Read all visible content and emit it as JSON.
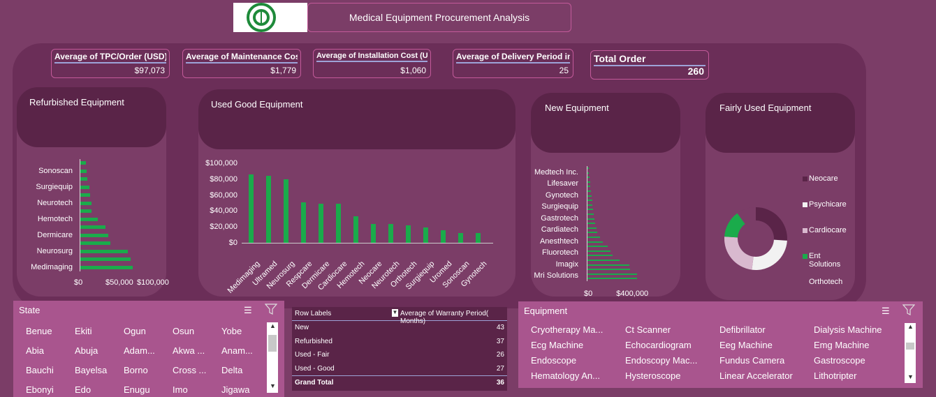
{
  "header": {
    "title": "Medical Equipment Procurement Analysis"
  },
  "kpis": [
    {
      "label": "Average of TPC/Order (USD)",
      "value": "$97,073"
    },
    {
      "label": "Average of Maintenance Cost",
      "value": "$1,779"
    },
    {
      "label": "Average of Installation Cost (USD)",
      "value": "$1,060"
    },
    {
      "label": "Average of Delivery Period in Days",
      "value": "25"
    },
    {
      "label": "Total Order",
      "value": "260"
    }
  ],
  "chart_data": [
    {
      "type": "bar",
      "orientation": "horizontal",
      "title": "Refurbished Equipment",
      "categories": [
        "Medimaging",
        "",
        "Neurosurg",
        "",
        "Dermicare",
        "",
        "Hemotech",
        "",
        "Neurotech",
        "",
        "Surgiequip",
        "",
        "Sonoscan",
        ""
      ],
      "tick_labels": [
        "Medimaging",
        "Neurosurg",
        "Dermicare",
        "Hemotech",
        "Neurotech",
        "Surgiequip",
        "Sonoscan"
      ],
      "values": [
        83000,
        80000,
        76000,
        48000,
        44000,
        40000,
        28000,
        18000,
        18000,
        16000,
        14000,
        11000,
        10000,
        9000
      ],
      "x_ticks": [
        "$0",
        "$50,000",
        "$100,000"
      ],
      "xlim": [
        0,
        100000
      ],
      "color": "#1aab4b"
    },
    {
      "type": "bar",
      "title": "Used Good Equipment",
      "categories": [
        "Medimaging",
        "Ultramed",
        "Neurosurg",
        "Respcare",
        "Dermicare",
        "Cardiocare",
        "Hemotech",
        "Neocare",
        "Neurotech",
        "Orthotech",
        "Surgiequip",
        "Uromed",
        "Sonoscan",
        "Gynotech"
      ],
      "values": [
        86000,
        84000,
        80000,
        51000,
        49000,
        49000,
        33000,
        24000,
        24000,
        22000,
        19000,
        16000,
        12000,
        12000
      ],
      "y_ticks": [
        "$100,000",
        "$80,000",
        "$60,000",
        "$40,000",
        "$20,000",
        "$0"
      ],
      "ylim": [
        0,
        100000
      ],
      "color": "#1aab4b"
    },
    {
      "type": "bar",
      "orientation": "horizontal",
      "title": "New Equipment",
      "tick_labels": [
        "Mri Solutions",
        "Imagix",
        "Fluorotech",
        "Anesthtech",
        "Cardiatech",
        "Gastrotech",
        "Surgiequip",
        "Gynotech",
        "Lifesaver",
        "Medtech Inc."
      ],
      "values": [
        395000,
        390000,
        335000,
        330000,
        255000,
        200000,
        180000,
        160000,
        120000,
        100000,
        80000,
        70000,
        60000,
        55000,
        50000,
        45000,
        40000,
        36000,
        32000,
        28000,
        24000,
        20000,
        16000,
        12000,
        9000
      ],
      "x_ticks": [
        "$0",
        "$400,000"
      ],
      "xlim": [
        0,
        520000
      ],
      "color": "#1aab4b"
    },
    {
      "type": "pie",
      "title": "Fairly Used Equipment",
      "labels": [
        "Neocare",
        "Psychicare",
        "Cardiocare",
        "Ent Solutions",
        "Orthotech"
      ],
      "values": [
        26,
        26,
        24,
        14,
        10
      ],
      "colors": [
        "#5a2448",
        "#f2f2f2",
        "#d9b9cf",
        "#1aab4b",
        "#7b3d67"
      ]
    }
  ],
  "state_slicer": {
    "title": "State",
    "items": [
      "Benue",
      "Ekiti",
      "Ogun",
      "Osun",
      "Yobe",
      "Abia",
      "Abuja",
      "Adam...",
      "Akwa ...",
      "Anam...",
      "Bauchi",
      "Bayelsa",
      "Borno",
      "Cross ...",
      "Delta",
      "Ebonyi",
      "Edo",
      "Enugu",
      "Imo",
      "Jigawa"
    ]
  },
  "pivot": {
    "header_labels": "Row Labels",
    "header_value": "Average of Warranty Period( Months)",
    "rows": [
      {
        "label": "New",
        "value": "43"
      },
      {
        "label": "Refurbished",
        "value": "37"
      },
      {
        "label": "Used - Fair",
        "value": "26"
      },
      {
        "label": "Used - Good",
        "value": "27"
      }
    ],
    "total": {
      "label": "Grand Total",
      "value": "36"
    }
  },
  "equipment_slicer": {
    "title": "Equipment",
    "items": [
      "Cryotherapy Ma...",
      "Ct Scanner",
      "Defibrillator",
      "Dialysis Machine",
      "Ecg Machine",
      "Echocardiogram",
      "Eeg Machine",
      "Emg Machine",
      "Endoscope",
      "Endoscopy Mac...",
      "Fundus Camera",
      "Gastroscope",
      "Hematology An...",
      "Hysteroscope",
      "Linear Accelerator",
      "Lithotripter"
    ]
  },
  "icons": {
    "multi_select": "multi-select-icon",
    "clear_filter": "clear-filter-icon"
  }
}
